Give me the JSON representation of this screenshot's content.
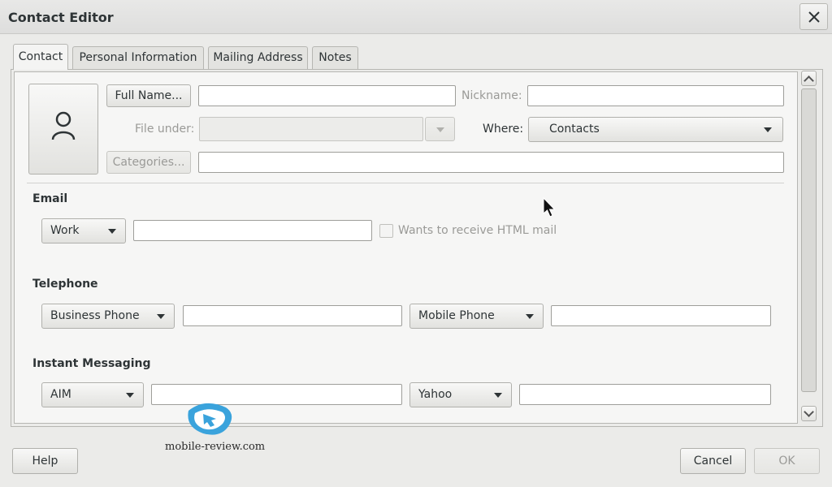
{
  "window": {
    "title": "Contact Editor"
  },
  "tabs": [
    {
      "label": "Contact"
    },
    {
      "label": "Personal Information"
    },
    {
      "label": "Mailing Address"
    },
    {
      "label": "Notes"
    }
  ],
  "identity": {
    "full_name_button": "Full Name...",
    "full_name_value": "",
    "nickname_label": "Nickname:",
    "nickname_value": "",
    "file_under_label": "File under:",
    "file_under_value": "",
    "where_label": "Where:",
    "where_value": "Contacts",
    "categories_button": "Categories...",
    "categories_value": ""
  },
  "email": {
    "heading": "Email",
    "type": "Work",
    "value": "",
    "html_mail_label": "Wants to receive HTML mail",
    "html_mail_checked": false
  },
  "telephone": {
    "heading": "Telephone",
    "phone1_type": "Business Phone",
    "phone1_value": "",
    "phone2_type": "Mobile Phone",
    "phone2_value": ""
  },
  "im": {
    "heading": "Instant Messaging",
    "im1_type": "AIM",
    "im1_value": "",
    "im2_type": "Yahoo",
    "im2_value": ""
  },
  "footer": {
    "help": "Help",
    "cancel": "Cancel",
    "ok": "OK"
  },
  "watermark": {
    "text": "mobile-review.com"
  },
  "icons": {
    "close": "close-icon",
    "avatar": "person-icon",
    "dropdown": "chevron-down-icon",
    "scroll_up": "chevron-up-icon",
    "scroll_down": "chevron-down-icon",
    "cursor": "mouse-pointer-icon"
  },
  "colors": {
    "background": "#ebebe9",
    "panel": "#f6f6f5",
    "text": "#2e3436",
    "disabled_text": "#9a9a97"
  }
}
